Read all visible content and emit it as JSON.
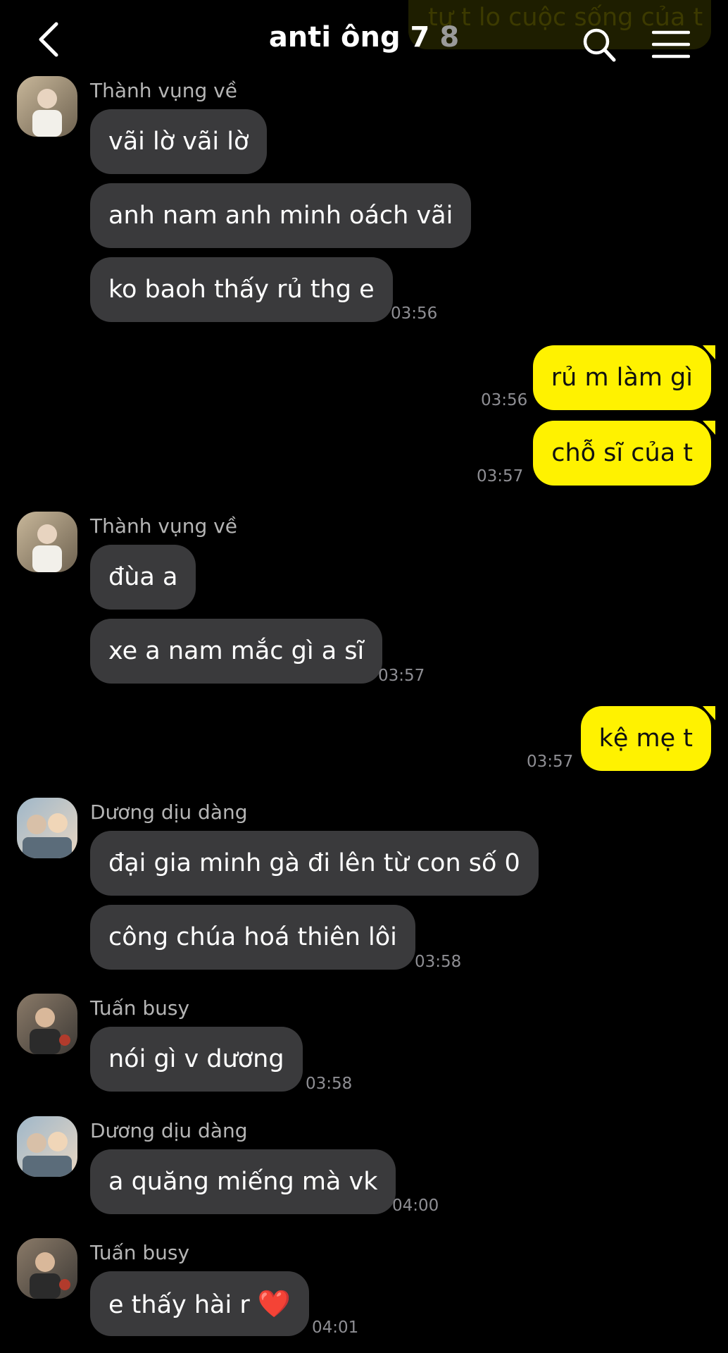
{
  "header": {
    "title": "anti ông 7",
    "member_count": "8",
    "back_icon": "chevron-left-icon",
    "search_icon": "search-icon",
    "menu_icon": "hamburger-menu-icon"
  },
  "peek_message": "tự t lo cuộc sống của t",
  "messages": [
    {
      "sender": "Thành vụng về",
      "texts": [
        "vãi lờ vãi lờ",
        "anh nam anh minh oách vãi",
        "ko baoh thấy rủ thg e"
      ],
      "time": "03:56"
    },
    {
      "outgoing": true,
      "text": "rủ m làm gì",
      "time": "03:56"
    },
    {
      "outgoing": true,
      "text": "chỗ sĩ của t",
      "time": "03:57"
    },
    {
      "sender": "Thành vụng về",
      "texts": [
        "đùa a",
        "xe a nam mắc gì a sĩ"
      ],
      "time": "03:57"
    },
    {
      "outgoing": true,
      "text": "kệ mẹ t",
      "time": "03:57"
    },
    {
      "sender": "Dương dịu dàng",
      "texts": [
        "đại gia minh gà đi lên từ con số 0",
        "công chúa hoá thiên lôi"
      ],
      "time": "03:58"
    },
    {
      "sender": "Tuấn busy",
      "texts": [
        "nói gì v dương"
      ],
      "time": "03:58"
    },
    {
      "sender": "Dương dịu dàng",
      "texts": [
        "a quăng miếng mà vk"
      ],
      "time": "04:00"
    },
    {
      "sender": "Tuấn busy",
      "texts": [
        "e thấy hài r"
      ],
      "emoji": "❤️",
      "time": "04:01"
    }
  ],
  "colors": {
    "background": "#000000",
    "incoming_bubble": "#3a3a3c",
    "outgoing_bubble": "#fff200",
    "timestamp": "#8e8e93"
  }
}
